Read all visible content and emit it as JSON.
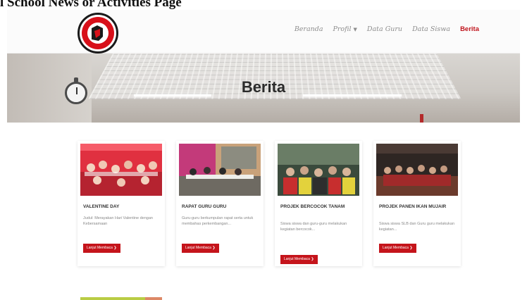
{
  "document_title": "l School News or Activities Page",
  "nav": {
    "items": [
      {
        "label": "Beranda",
        "active": false
      },
      {
        "label": "Profil",
        "active": false,
        "has_dropdown": true
      },
      {
        "label": "Data Guru",
        "active": false
      },
      {
        "label": "Data Siswa",
        "active": false
      },
      {
        "label": "Berita",
        "active": true
      }
    ],
    "active_color": "#c0141c"
  },
  "hero": {
    "title": "Berita"
  },
  "cards": [
    {
      "title": "VALENTINE DAY",
      "desc": "Judul: Merayakan Hari Valentine dengan Kebersamaan",
      "button": "Lanjut Membaca ❯"
    },
    {
      "title": "RAPAT GURU GURU",
      "desc": "Guru-guru berkumpulan rapat serta untuk membahas perkembangan...",
      "button": "Lanjut Membaca ❯"
    },
    {
      "title": "PROJEK BERCOCOK TANAM",
      "desc": "Siswa siswa dan guru-guru melakukan kegiatan bercocok...",
      "button": "Lanjut Membaca ❯"
    },
    {
      "title": "PROJEK PANEN IKAN MUJAIR",
      "desc": "Siswa siswa SLB dan Guru guru melakukan kegiatan...",
      "button": "Lanjut Membaca ❯"
    }
  ]
}
